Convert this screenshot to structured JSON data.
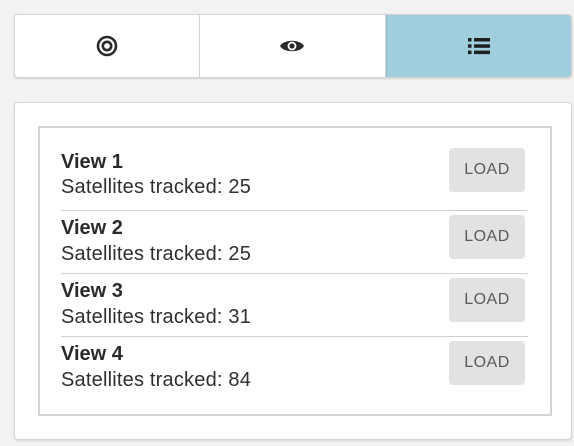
{
  "tabs": [
    {
      "id": "orbit",
      "icon": "orbit-target-icon",
      "active": false
    },
    {
      "id": "view",
      "icon": "eye-icon",
      "active": false
    },
    {
      "id": "list",
      "icon": "list-icon",
      "active": true
    }
  ],
  "colors": {
    "active_tab": "#9fcfdd",
    "button_bg": "#e1e2e3",
    "border": "#d3d3d3"
  },
  "views": [
    {
      "title": "View 1",
      "subtitle": "Satellites tracked: 25",
      "button": "LOAD"
    },
    {
      "title": "View 2",
      "subtitle": "Satellites tracked: 25",
      "button": "LOAD"
    },
    {
      "title": "View 3",
      "subtitle": "Satellites tracked: 31",
      "button": "LOAD"
    },
    {
      "title": "View 4",
      "subtitle": "Satellites tracked: 84",
      "button": "LOAD"
    }
  ]
}
